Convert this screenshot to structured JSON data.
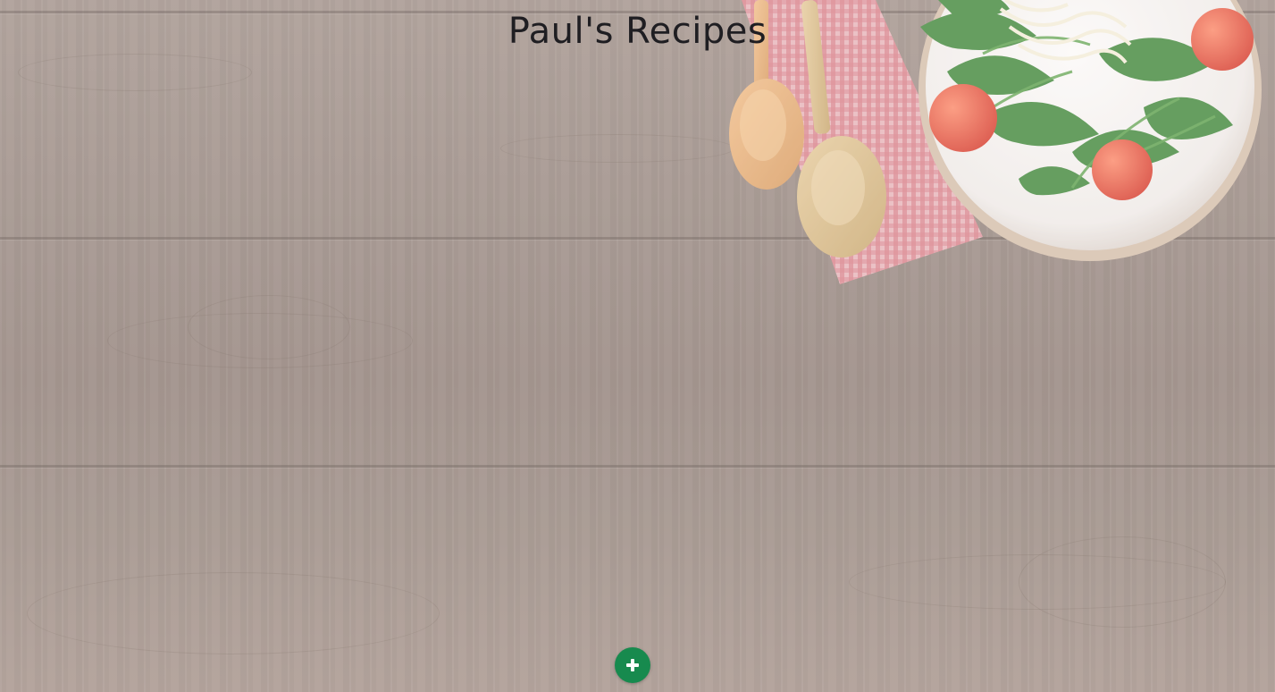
{
  "page": {
    "title": "Paul's Recipes"
  },
  "actions": {
    "add_recipe_icon": "plus-icon"
  },
  "colors": {
    "title_text": "#1f1e22",
    "add_button_bg": "#178a4e",
    "add_button_icon": "#ffffff"
  },
  "background": {
    "image": "wooden-table-with-salad",
    "elements": [
      "salad-plate",
      "wooden-spoon",
      "wooden-spoon",
      "checkered-napkin"
    ]
  }
}
